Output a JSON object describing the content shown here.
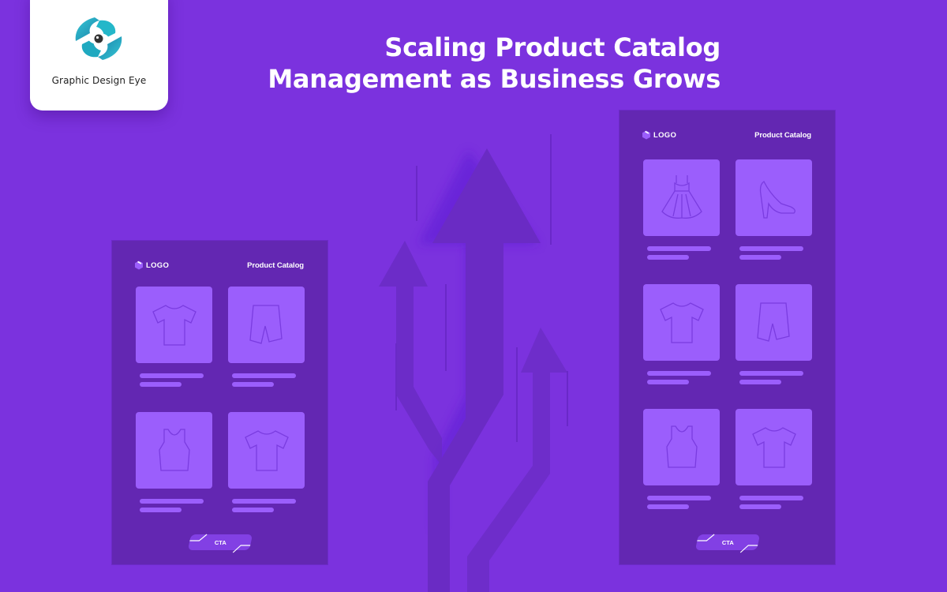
{
  "brand": {
    "name": "Graphic Design Eye",
    "logo_icon": "eye-swirl-logo-icon",
    "colors": {
      "logo_primary": "#1fb6c6",
      "logo_secondary": "#2a9fc0"
    }
  },
  "headline": {
    "line1": "Scaling Product Catalog",
    "line2": "Management as Business Grows"
  },
  "colors": {
    "background": "#7b32de",
    "panel": "#6327b2",
    "thumb": "#9b5efc",
    "arrow": "#6a2bc4",
    "text": "#ffffff"
  },
  "arrows_icon": "growth-arrows-icon",
  "panels": [
    {
      "id": "small",
      "logo_label": "LOGO",
      "title": "Product Catalog",
      "cta_label": "CTA",
      "products": [
        {
          "icon": "tshirt-icon"
        },
        {
          "icon": "shorts-icon"
        },
        {
          "icon": "tank-top-icon"
        },
        {
          "icon": "tshirt-icon"
        }
      ]
    },
    {
      "id": "large",
      "logo_label": "LOGO",
      "title": "Product Catalog",
      "cta_label": "CTA",
      "products": [
        {
          "icon": "dress-icon"
        },
        {
          "icon": "high-heel-icon"
        },
        {
          "icon": "tshirt-icon"
        },
        {
          "icon": "shorts-icon"
        },
        {
          "icon": "tank-top-icon"
        },
        {
          "icon": "tshirt-icon"
        }
      ]
    }
  ]
}
